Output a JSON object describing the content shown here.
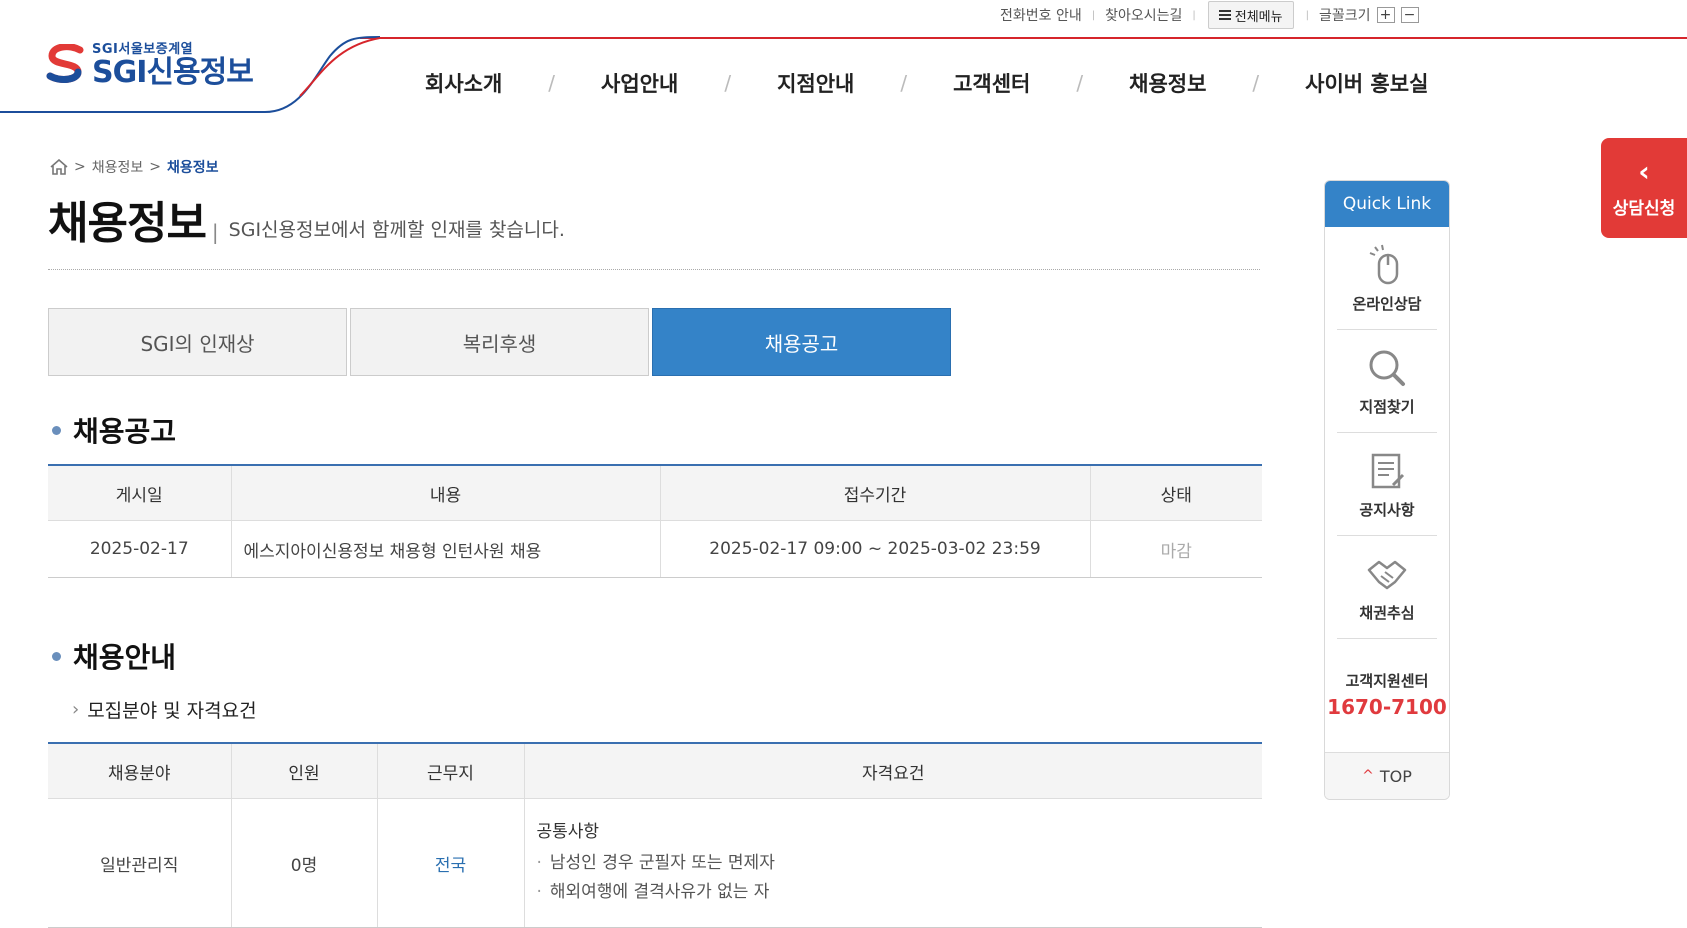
{
  "util": {
    "phone_info": "전화번호 안내",
    "directions": "찾아오시는길",
    "all_menu": "전체메뉴",
    "font_size": "글꼴크기",
    "font_plus": "+",
    "font_minus": "−"
  },
  "logo": {
    "sub": "SGI서울보증계열",
    "main": "SGI신용정보"
  },
  "gnb": [
    "회사소개",
    "사업안내",
    "지점안내",
    "고객센터",
    "채용정보",
    "사이버 홍보실"
  ],
  "breadcrumb": {
    "level1": "채용정보",
    "current": "채용정보"
  },
  "page": {
    "title": "채용정보",
    "description": "SGI신용정보에서 함께할 인재를 찾습니다."
  },
  "tabs": [
    "SGI의 인재상",
    "복리후생",
    "채용공고"
  ],
  "notice_section": {
    "heading": "채용공고",
    "headers": [
      "게시일",
      "내용",
      "접수기간",
      "상태"
    ],
    "rows": [
      [
        "2025-02-17",
        "에스지아이신용정보 채용형 인턴사원 채용",
        "2025-02-17 09:00 ~ 2025-03-02 23:59",
        "마감"
      ]
    ]
  },
  "guide_section": {
    "heading": "채용안내",
    "subheading": "모집분야 및 자격요건",
    "headers": [
      "채용분야",
      "인원",
      "근무지",
      "자격요건"
    ],
    "row": {
      "field": "일반관리직",
      "count": "0명",
      "location": "전국",
      "req_title": "공통사항",
      "req_items": [
        "남성인 경우 군필자 또는 면제자",
        "해외여행에 결격사유가 없는 자"
      ]
    }
  },
  "quick_link": {
    "title": "Quick Link",
    "items": [
      "온라인상담",
      "지점찾기",
      "공지사항",
      "채권추심"
    ],
    "cs_label": "고객지원센터",
    "cs_phone": "1670-7100",
    "top": "TOP"
  },
  "consult": {
    "label": "상담신청"
  },
  "colors": {
    "brand_blue": "#1c4e9b",
    "accent_red": "#e23a37",
    "tab_active": "#3483c8"
  }
}
